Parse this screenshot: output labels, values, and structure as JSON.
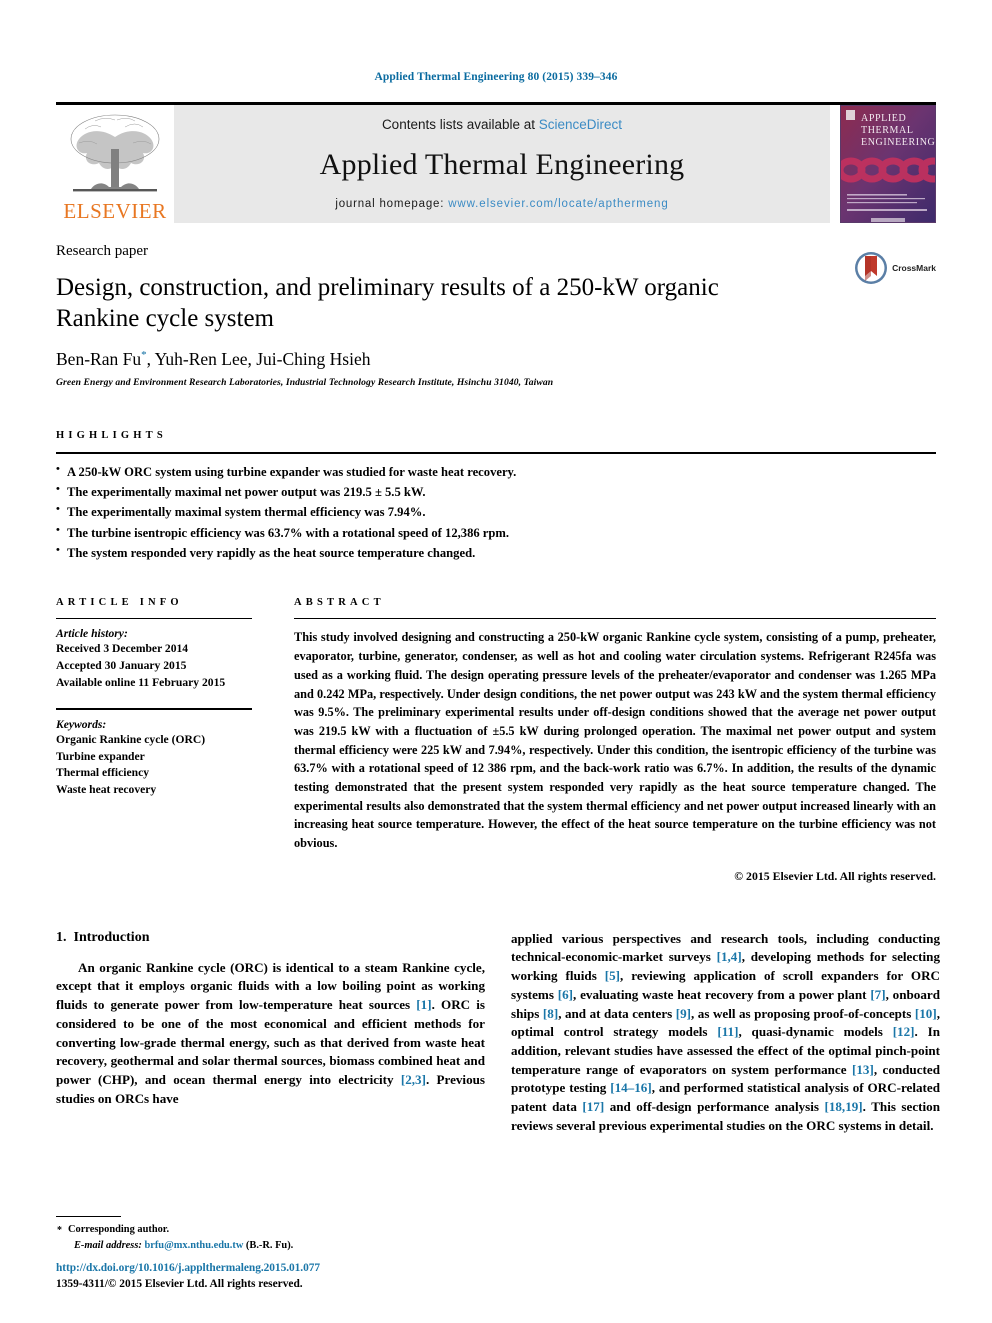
{
  "running_head": "Applied Thermal Engineering 80 (2015) 339–346",
  "masthead": {
    "publisher_logo_text": "ELSEVIER",
    "contents_prefix": "Contents lists available at ",
    "contents_link": "ScienceDirect",
    "journal_title": "Applied Thermal Engineering",
    "homepage_prefix": "journal homepage: ",
    "homepage_link": "www.elsevier.com/locate/apthermeng",
    "cover_title_lines": [
      "APPLIED",
      "THERMAL",
      "ENGINEERING"
    ]
  },
  "article": {
    "type": "Research paper",
    "title": "Design, construction, and preliminary results of a 250-kW organic Rankine cycle system",
    "authors": "Ben-Ran Fu",
    "authors_rest": ", Yuh-Ren Lee, Jui-Ching Hsieh",
    "corresponding_marker": "*",
    "affiliation": "Green Energy and Environment Research Laboratories, Industrial Technology Research Institute, Hsinchu 31040, Taiwan",
    "crossmark_label": "CrossMark"
  },
  "highlights": {
    "heading": "HIGHLIGHTS",
    "items": [
      "A 250-kW ORC system using turbine expander was studied for waste heat recovery.",
      "The experimentally maximal net power output was 219.5 ± 5.5 kW.",
      "The experimentally maximal system thermal efficiency was 7.94%.",
      "The turbine isentropic efficiency was 63.7% with a rotational speed of 12,386 rpm.",
      "The system responded very rapidly as the heat source temperature changed."
    ]
  },
  "article_info": {
    "heading": "ARTICLE INFO",
    "history_label": "Article history:",
    "history": [
      "Received 3 December 2014",
      "Accepted 30 January 2015",
      "Available online 11 February 2015"
    ],
    "keywords_label": "Keywords:",
    "keywords": [
      "Organic Rankine cycle (ORC)",
      "Turbine expander",
      "Thermal efficiency",
      "Waste heat recovery"
    ]
  },
  "abstract": {
    "heading": "ABSTRACT",
    "text": "This study involved designing and constructing a 250-kW organic Rankine cycle system, consisting of a pump, preheater, evaporator, turbine, generator, condenser, as well as hot and cooling water circulation systems. Refrigerant R245fa was used as a working fluid. The design operating pressure levels of the preheater/evaporator and condenser was 1.265 MPa and 0.242 MPa, respectively. Under design conditions, the net power output was 243 kW and the system thermal efficiency was 9.5%. The preliminary experimental results under off-design conditions showed that the average net power output was 219.5 kW with a fluctuation of ±5.5 kW during prolonged operation. The maximal net power output and system thermal efficiency were 225 kW and 7.94%, respectively. Under this condition, the isentropic efficiency of the turbine was 63.7% with a rotational speed of 12 386 rpm, and the back-work ratio was 6.7%. In addition, the results of the dynamic testing demonstrated that the present system responded very rapidly as the heat source temperature changed. The experimental results also demonstrated that the system thermal efficiency and net power output increased linearly with an increasing heat source temperature. However, the effect of the heat source temperature on the turbine efficiency was not obvious.",
    "copyright": "© 2015 Elsevier Ltd. All rights reserved."
  },
  "introduction": {
    "number": "1.",
    "title": "Introduction",
    "left_paragraph_parts": [
      "An organic Rankine cycle (ORC) is identical to a steam Rankine cycle, except that it employs organic fluids with a low boiling point as working fluids to generate power from low-temperature heat sources ",
      "[1]",
      ". ORC is considered to be one of the most economical and efficient methods for converting low-grade thermal energy, such as that derived from waste heat recovery, geothermal and solar thermal sources, biomass combined heat and power (CHP), and ocean thermal energy into electricity ",
      "[2,3]",
      ". Previous studies on ORCs have"
    ],
    "right_paragraph_parts": [
      "applied various perspectives and research tools, including conducting technical-economic-market surveys ",
      "[1,4]",
      ", developing methods for selecting working fluids ",
      "[5]",
      ", reviewing application of scroll expanders for ORC systems ",
      "[6]",
      ", evaluating waste heat recovery from a power plant ",
      "[7]",
      ", onboard ships ",
      "[8]",
      ", and at data centers ",
      "[9]",
      ", as well as proposing proof-of-concepts ",
      "[10]",
      ", optimal control strategy models ",
      "[11]",
      ", quasi-dynamic models ",
      "[12]",
      ". In addition, relevant studies have assessed the effect of the optimal pinch-point temperature range of evaporators on system performance ",
      "[13]",
      ", conducted prototype testing ",
      "[14–16]",
      ", and performed statistical analysis of ORC-related patent data ",
      "[17]",
      " and off-design performance analysis ",
      "[18,19]",
      ". This section reviews several previous experimental studies on the ORC systems in detail."
    ]
  },
  "footnote": {
    "corresponding_author": "Corresponding author.",
    "email_label": "E-mail address:",
    "email": "brfu@mx.nthu.edu.tw",
    "email_suffix": " (B.-R. Fu)."
  },
  "page_footer": {
    "doi": "http://dx.doi.org/10.1016/j.applthermaleng.2015.01.077",
    "issn_prefix": "1359-4311/",
    "issn_rest": "© 2015 Elsevier Ltd. All rights reserved."
  },
  "colors": {
    "link_blue": "#1a76a8",
    "sciencedirect_blue": "#3b8bc4",
    "elsevier_orange": "#E87722",
    "masthead_gray": "#e8e8e8"
  }
}
